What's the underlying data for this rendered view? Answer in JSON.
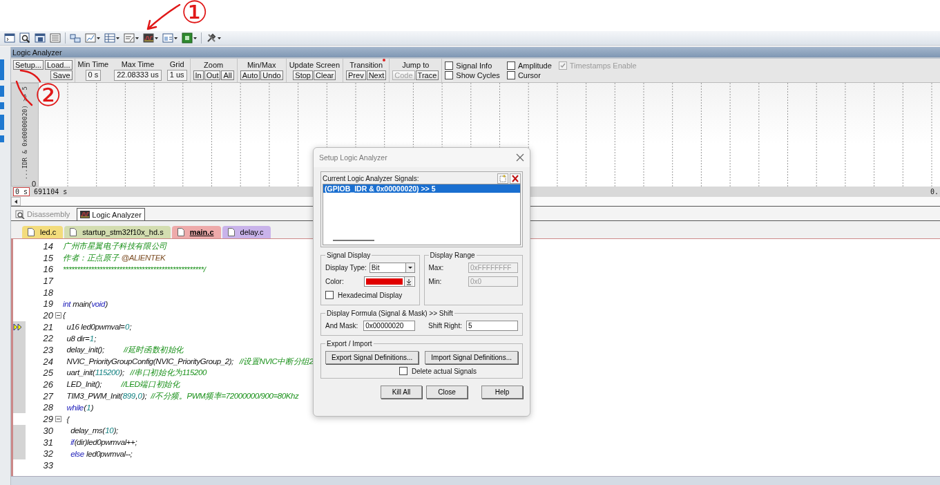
{
  "annotations": [
    {
      "label": "①"
    },
    {
      "label": "②"
    }
  ],
  "logic_analyzer": {
    "title": "Logic Analyzer",
    "file_buttons": [
      {
        "label": "Setup..."
      },
      {
        "label": "Load..."
      },
      {
        "label": "Save"
      }
    ],
    "time_fields": [
      {
        "label": "Min Time",
        "value": "0 s"
      },
      {
        "label": "Max Time",
        "value": "22.08333 us"
      },
      {
        "label": "Grid",
        "value": "1 us"
      }
    ],
    "button_groups": [
      {
        "label": "Zoom",
        "buttons": [
          {
            "label": "In",
            "disabled": false
          },
          {
            "label": "Out",
            "disabled": false
          },
          {
            "label": "All",
            "disabled": false
          }
        ]
      },
      {
        "label": "Min/Max",
        "buttons": [
          {
            "label": "Auto",
            "disabled": false
          },
          {
            "label": "Undo",
            "disabled": false
          }
        ]
      },
      {
        "label": "Update Screen",
        "buttons": [
          {
            "label": "Stop",
            "disabled": false
          },
          {
            "label": "Clear",
            "disabled": false
          }
        ]
      },
      {
        "label": "Transition",
        "marked": true,
        "buttons": [
          {
            "label": "Prev",
            "disabled": false
          },
          {
            "label": "Next",
            "disabled": false
          }
        ]
      },
      {
        "label": "Jump to",
        "buttons": [
          {
            "label": "Code",
            "disabled": true
          },
          {
            "label": "Trace",
            "disabled": false
          }
        ]
      }
    ],
    "options": [
      {
        "label": "Signal Info",
        "checked": false,
        "disabled": false
      },
      {
        "label": "Show Cycles",
        "checked": false,
        "disabled": false
      },
      {
        "label": "Amplitude",
        "checked": false,
        "disabled": false
      },
      {
        "label": "Cursor",
        "checked": false,
        "disabled": false
      },
      {
        "label": "Timestamps Enable",
        "checked": true,
        "disabled": true
      }
    ],
    "signal_label": "...IDR & 0x00000020) >> 5",
    "axis_min": "0",
    "time_start": "0 s",
    "time_cursor": "691104 s",
    "time_end": "0."
  },
  "view_tabs": [
    {
      "label": "Disassembly",
      "selected": false
    },
    {
      "label": "Logic Analyzer",
      "selected": true
    }
  ],
  "file_tabs": [
    {
      "label": "led.c",
      "color": "#f3dc7c",
      "selected": false
    },
    {
      "label": "startup_stm32f10x_hd.s",
      "color": "#d3ddb0",
      "selected": false
    },
    {
      "label": "main.c",
      "color": "#eeaaaa",
      "selected": true
    },
    {
      "label": "delay.c",
      "color": "#c9b3ea",
      "selected": false
    }
  ],
  "code_lines": [
    {
      "number": "14",
      "segments": [
        {
          "kind": "comment",
          "text": "广州市星翼电子科技有限公司"
        }
      ]
    },
    {
      "number": "15",
      "segments": [
        {
          "kind": "comment",
          "text": "作者：正点原子 "
        },
        {
          "kind": "tag",
          "text": "@ALIENTEK"
        }
      ]
    },
    {
      "number": "16",
      "segments": [
        {
          "kind": "comment",
          "text": "**************************************************/"
        }
      ]
    },
    {
      "number": "17"
    },
    {
      "number": "18"
    },
    {
      "number": "19",
      "segments": [
        {
          "kind": "keyword",
          "text": "int"
        },
        {
          "kind": "code",
          "text": " main("
        },
        {
          "kind": "keyword",
          "text": "void"
        },
        {
          "kind": "code",
          "text": ")"
        }
      ]
    },
    {
      "number": "20",
      "fold": true,
      "segments": [
        {
          "kind": "code",
          "text": "{"
        }
      ]
    },
    {
      "number": "21",
      "current": true,
      "executable": true,
      "segments": [
        {
          "kind": "code",
          "text": "  u16 led0pwmval="
        },
        {
          "kind": "number",
          "text": "0"
        },
        {
          "kind": "code",
          "text": ";"
        }
      ]
    },
    {
      "number": "22",
      "executable": true,
      "segments": [
        {
          "kind": "code",
          "text": "  u8 dir="
        },
        {
          "kind": "number",
          "text": "1"
        },
        {
          "kind": "code",
          "text": ";"
        }
      ]
    },
    {
      "number": "23",
      "executable": true,
      "segments": [
        {
          "kind": "code",
          "text": "  delay_init();"
        },
        {
          "kind": "comment",
          "text": "          //延时函数初始化"
        }
      ]
    },
    {
      "number": "24",
      "executable": true,
      "segments": [
        {
          "kind": "code",
          "text": "  NVIC_PriorityGroupConfig(NVIC_PriorityGroup_2);"
        },
        {
          "kind": "comment",
          "text": "   //设置NVIC中断分组2"
        }
      ]
    },
    {
      "number": "25",
      "executable": true,
      "segments": [
        {
          "kind": "code",
          "text": "  uart_init("
        },
        {
          "kind": "number",
          "text": "115200"
        },
        {
          "kind": "code",
          "text": ");"
        },
        {
          "kind": "comment",
          "text": "   //串口初始化为115200"
        }
      ]
    },
    {
      "number": "26",
      "executable": true,
      "segments": [
        {
          "kind": "code",
          "text": "  LED_Init();"
        },
        {
          "kind": "comment",
          "text": "          //LED端口初始化"
        }
      ]
    },
    {
      "number": "27",
      "executable": true,
      "segments": [
        {
          "kind": "code",
          "text": "  TIM3_PWM_Init("
        },
        {
          "kind": "number",
          "text": "899"
        },
        {
          "kind": "code",
          "text": ","
        },
        {
          "kind": "number",
          "text": "0"
        },
        {
          "kind": "code",
          "text": ");"
        },
        {
          "kind": "comment",
          "text": "  //不分频。PWM频率=72000000/900=80Khz"
        }
      ]
    },
    {
      "number": "28",
      "executable": true,
      "segments": [
        {
          "kind": "keyword",
          "text": "  while"
        },
        {
          "kind": "code",
          "text": "("
        },
        {
          "kind": "number",
          "text": "1"
        },
        {
          "kind": "code",
          "text": ")"
        }
      ]
    },
    {
      "number": "29",
      "fold": true,
      "segments": [
        {
          "kind": "code",
          "text": "  {"
        }
      ]
    },
    {
      "number": "30",
      "executable": true,
      "segments": [
        {
          "kind": "code",
          "text": "    delay_ms("
        },
        {
          "kind": "number",
          "text": "10"
        },
        {
          "kind": "code",
          "text": ");"
        }
      ]
    },
    {
      "number": "31",
      "executable": true,
      "segments": [
        {
          "kind": "keyword",
          "text": "    if"
        },
        {
          "kind": "code",
          "text": "(dir)led0pwmval++;"
        }
      ]
    },
    {
      "number": "32",
      "executable": true,
      "segments": [
        {
          "kind": "keyword",
          "text": "    else"
        },
        {
          "kind": "code",
          "text": " led0pwmval--;"
        }
      ]
    },
    {
      "number": "33"
    }
  ],
  "dialog": {
    "title": "Setup Logic Analyzer",
    "signals_label": "Current Logic Analyzer Signals:",
    "signals": [
      {
        "text": "(GPIOB_IDR & 0x00000020) >> 5",
        "selected": true
      }
    ],
    "signal_display": {
      "title": "Signal Display",
      "type_label": "Display Type:",
      "type_value": "Bit",
      "color_label": "Color:",
      "color": "#e00000",
      "hex_label": "Hexadecimal Display",
      "hex_checked": false
    },
    "display_range": {
      "title": "Display Range",
      "max_label": "Max:",
      "max_value": "0xFFFFFFFF",
      "min_label": "Min:",
      "min_value": "0x0",
      "disabled": true
    },
    "formula": {
      "title": "Display Formula (Signal & Mask) >> Shift",
      "mask_label": "And Mask:",
      "mask_value": "0x00000020",
      "shift_label": "Shift Right:",
      "shift_value": "5"
    },
    "export_import": {
      "title": "Export / Import",
      "export_button": "Export Signal Definitions...",
      "import_button": "Import Signal Definitions...",
      "delete_label": "Delete actual Signals",
      "delete_checked": false
    },
    "buttons": [
      "Kill All",
      "Close",
      "Help"
    ]
  }
}
